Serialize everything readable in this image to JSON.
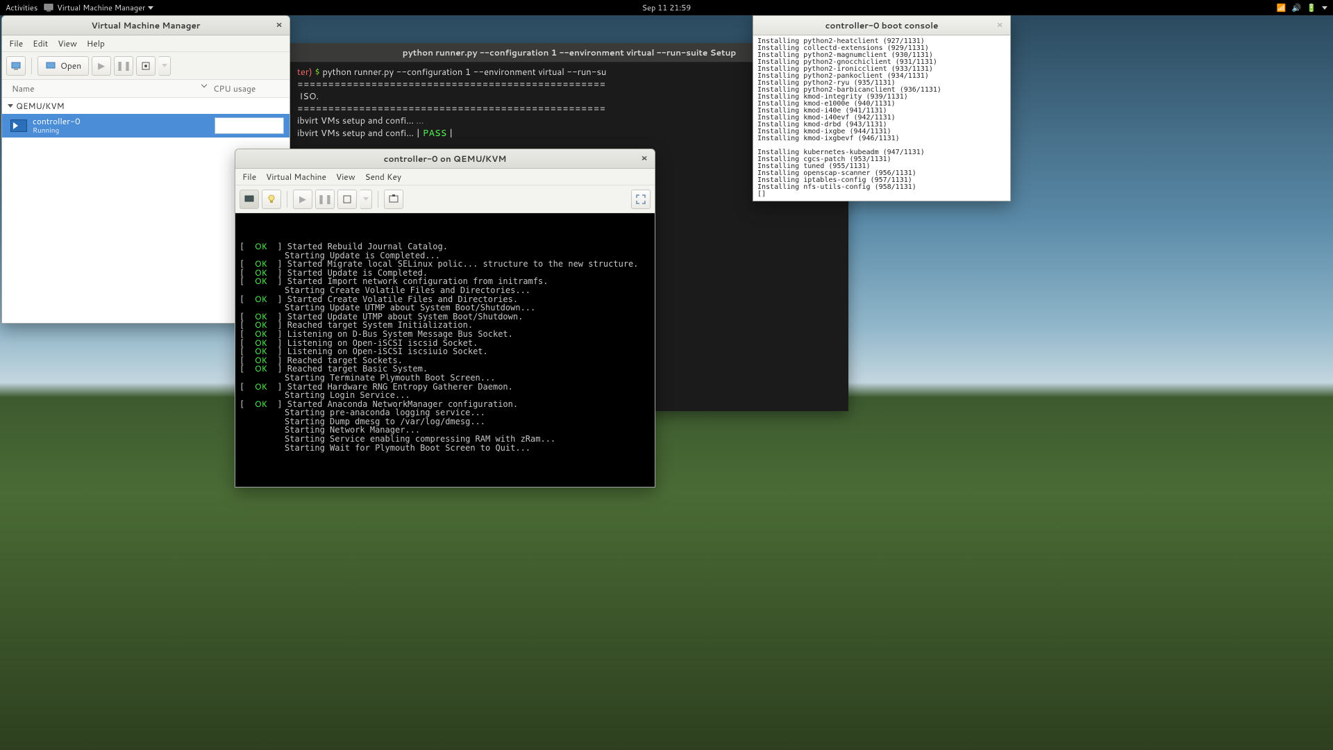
{
  "topbar": {
    "activities": "Activities",
    "app_name": "Virtual Machine Manager",
    "clock": "Sep 11  21:59"
  },
  "vmm_window": {
    "title": "Virtual Machine Manager",
    "menus": [
      "File",
      "Edit",
      "View",
      "Help"
    ],
    "open_label": "Open",
    "col_name": "Name",
    "col_cpu": "CPU usage",
    "group": "QEMU/KVM",
    "vm_name": "controller-0",
    "vm_state": "Running"
  },
  "terminal_back": {
    "title": "python runner.py --configuration 1 --environment virtual --run-suite Setup",
    "prompt_close": "ter)",
    "dollar": " $ ",
    "command": "python runner.py --configuration 1 --environment virtual --run-su",
    "line1": "==================================================",
    "line2": " ISO.",
    "line3": "==================================================",
    "line4": "ibvirt VMs setup and confi... ",
    "line4b": "...",
    "line5": "ibvirt VMs setup and confi... | ",
    "pass": "PASS",
    "bar": " |"
  },
  "vmconsole_window": {
    "title": "controller-0 on QEMU/KVM",
    "menus": [
      "File",
      "Virtual Machine",
      "View",
      "Send Key"
    ],
    "boot_lines": [
      {
        "ok": true,
        "t": "Started Rebuild Journal Catalog."
      },
      {
        "ok": false,
        "t": "Starting Update is Completed..."
      },
      {
        "ok": true,
        "t": "Started Migrate local SELinux polic... structure to the new structure."
      },
      {
        "ok": true,
        "t": "Started Update is Completed."
      },
      {
        "ok": true,
        "t": "Started Import network configuration from initramfs."
      },
      {
        "ok": false,
        "t": "Starting Create Volatile Files and Directories..."
      },
      {
        "ok": true,
        "t": "Started Create Volatile Files and Directories."
      },
      {
        "ok": false,
        "t": "Starting Update UTMP about System Boot/Shutdown..."
      },
      {
        "ok": true,
        "t": "Started Update UTMP about System Boot/Shutdown."
      },
      {
        "ok": true,
        "t": "Reached target System Initialization."
      },
      {
        "ok": true,
        "t": "Listening on D-Bus System Message Bus Socket."
      },
      {
        "ok": true,
        "t": "Listening on Open-iSCSI iscsid Socket."
      },
      {
        "ok": true,
        "t": "Listening on Open-iSCSI iscsiuio Socket."
      },
      {
        "ok": true,
        "t": "Reached target Sockets."
      },
      {
        "ok": true,
        "t": "Reached target Basic System."
      },
      {
        "ok": false,
        "t": "Starting Terminate Plymouth Boot Screen..."
      },
      {
        "ok": true,
        "t": "Started Hardware RNG Entropy Gatherer Daemon."
      },
      {
        "ok": false,
        "t": "Starting Login Service..."
      },
      {
        "ok": true,
        "t": "Started Anaconda NetworkManager configuration."
      },
      {
        "ok": false,
        "t": "Starting pre-anaconda logging service..."
      },
      {
        "ok": false,
        "t": "Starting Dump dmesg to /var/log/dmesg..."
      },
      {
        "ok": false,
        "t": "Starting Network Manager..."
      },
      {
        "ok": false,
        "t": "Starting Service enabling compressing RAM with zRam..."
      },
      {
        "ok": false,
        "t": "Starting Wait for Plymouth Boot Screen to Quit..."
      }
    ]
  },
  "boot_console": {
    "title": "controller-0 boot console",
    "lines": [
      "Installing python2-heatclient (927/1131)",
      "Installing collectd-extensions (929/1131)",
      "Installing python2-magnumclient (930/1131)",
      "Installing python2-gnocchiclient (931/1131)",
      "Installing python2-ironicclient (933/1131)",
      "Installing python2-pankoclient (934/1131)",
      "Installing python2-ryu (935/1131)",
      "Installing python2-barbicanclient (936/1131)",
      "Installing kmod-integrity (939/1131)",
      "Installing kmod-e1000e (940/1131)",
      "Installing kmod-i40e (941/1131)",
      "Installing kmod-i40evf (942/1131)",
      "Installing kmod-drbd (943/1131)",
      "Installing kmod-ixgbe (944/1131)",
      "Installing kmod-ixgbevf (946/1131)",
      "",
      "Installing kubernetes-kubeadm (947/1131)",
      "Installing cgcs-patch (953/1131)",
      "Installing tuned (955/1131)",
      "Installing openscap-scanner (956/1131)",
      "Installing iptables-config (957/1131)",
      "Installing nfs-utils-config (958/1131)",
      "[]"
    ]
  }
}
